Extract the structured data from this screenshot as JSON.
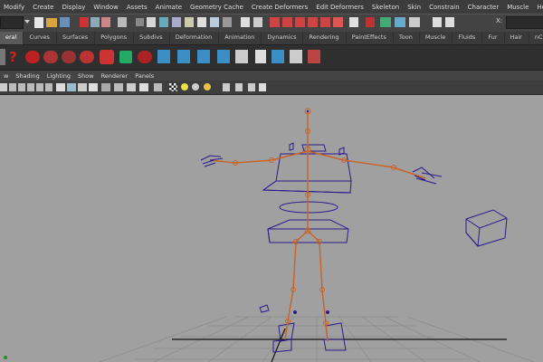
{
  "menubar": {
    "items": [
      "Modify",
      "Create",
      "Display",
      "Window",
      "Assets",
      "Animate",
      "Geometry Cache",
      "Create Deformers",
      "Edit Deformers",
      "Skeleton",
      "Skin",
      "Constrain",
      "Character",
      "Muscle",
      "Help"
    ]
  },
  "statusline": {
    "x_label": "X:"
  },
  "shelf_tabs": {
    "items": [
      "eral",
      "Curves",
      "Surfaces",
      "Polygons",
      "Subdivs",
      "Deformation",
      "Animation",
      "Dynamics",
      "Rendering",
      "PaintEffects",
      "Toon",
      "Muscle",
      "Fluids",
      "Fur",
      "Hair",
      "nCloth"
    ],
    "active": "eral"
  },
  "panel_menu": {
    "items": [
      "w",
      "Shading",
      "Lighting",
      "Show",
      "Renderer",
      "Panels"
    ]
  },
  "colors": {
    "viewport": "#a0a0a0",
    "bone": "#c8642a",
    "wire": "#2a1c8c",
    "grid": "#8a8a8a"
  }
}
